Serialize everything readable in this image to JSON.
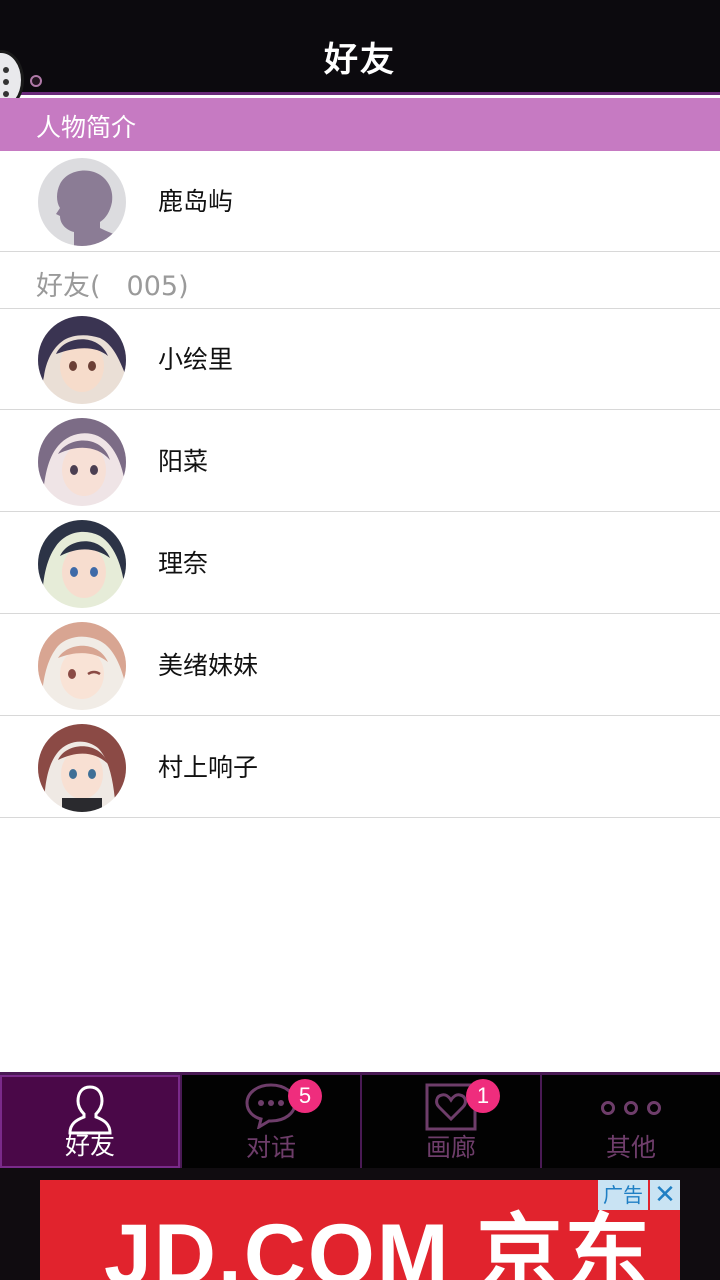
{
  "header": {
    "title": "好友"
  },
  "profile_section": {
    "label": "人物简介"
  },
  "profile": {
    "name": "鹿岛屿"
  },
  "friends_section": {
    "label_prefix": "好友(",
    "count": "005",
    "label_suffix": ")"
  },
  "friends": [
    {
      "name": "小绘里"
    },
    {
      "name": "阳菜"
    },
    {
      "name": "理奈"
    },
    {
      "name": "美绪妹妹"
    },
    {
      "name": "村上响子"
    }
  ],
  "tabs": [
    {
      "label": "好友",
      "icon": "person-icon",
      "active": true
    },
    {
      "label": "对话",
      "icon": "chat-bubble-icon",
      "badge": "5"
    },
    {
      "label": "画廊",
      "icon": "gallery-heart-icon",
      "badge": "1"
    },
    {
      "label": "其他",
      "icon": "more-dots-icon"
    }
  ],
  "ad": {
    "text": "JD.COM 京东",
    "tag": "广告",
    "close": "✕"
  },
  "colors": {
    "topbar": "#0c0a0e",
    "section_header": "#c67ac2",
    "tab_active": "#4a0848",
    "badge": "#ef2d7d",
    "ad": "#e1232d"
  }
}
